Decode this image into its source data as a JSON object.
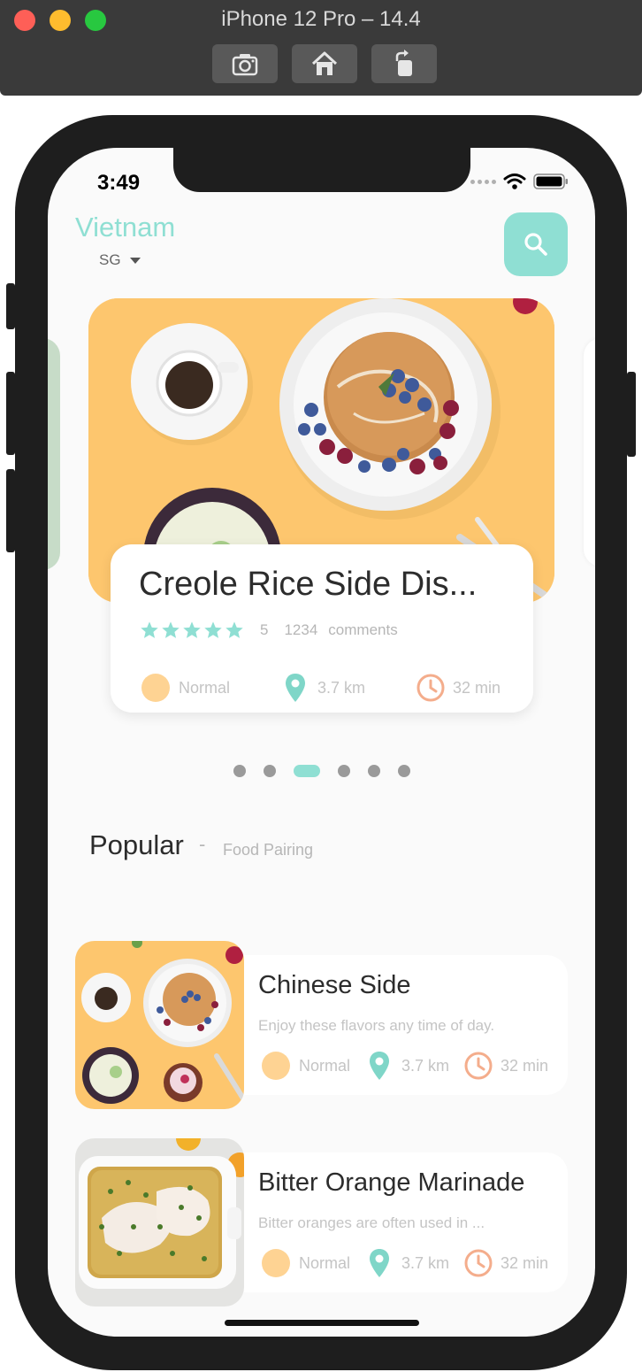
{
  "simulator": {
    "title": "iPhone 12 Pro – 14.4",
    "toolbar": [
      {
        "name": "screenshot-button",
        "icon": "camera-icon"
      },
      {
        "name": "home-button",
        "icon": "home-icon"
      },
      {
        "name": "rotate-button",
        "icon": "rotate-icon"
      }
    ]
  },
  "status_bar": {
    "time": "3:49"
  },
  "header": {
    "country": "Vietnam",
    "city": "SG",
    "search_icon": "search-icon",
    "accent_color": "#8fdfd3"
  },
  "featured": {
    "title": "Creole Rice Side Dis...",
    "rating": "5",
    "comments_count": "1234",
    "comments_label": "comments",
    "difficulty": "Normal",
    "distance": "3.7 km",
    "time": "32 min",
    "star_color": "#8fdfd3",
    "image_bg": "#fdc66e",
    "carousel_pages": 6,
    "active_page": 3
  },
  "popular": {
    "title": "Popular",
    "separator": "-",
    "subtitle": "Food Pairing",
    "items": [
      {
        "title": "Chinese Side",
        "description": "Enjoy these flavors any time of day.",
        "difficulty": "Normal",
        "distance": "3.7 km",
        "time": "32 min"
      },
      {
        "title": "Bitter Orange Marinade",
        "description": "Bitter oranges are often used in ...",
        "difficulty": "Normal",
        "distance": "3.7 km",
        "time": "32 min"
      }
    ]
  }
}
